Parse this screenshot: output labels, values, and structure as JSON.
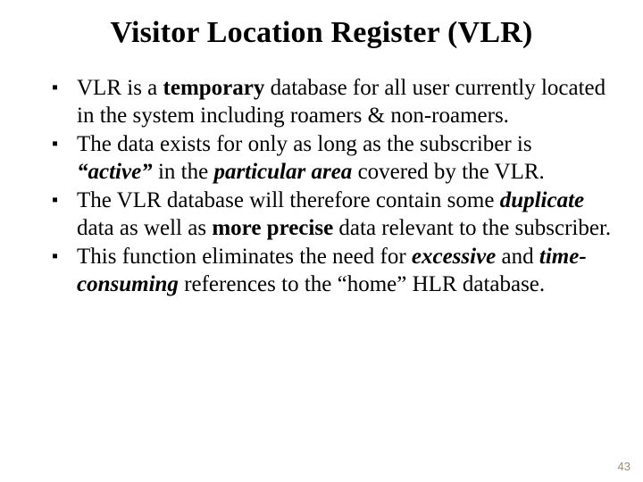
{
  "title": "Visitor Location Register (VLR)",
  "bullets": {
    "b1": {
      "t1": "VLR is a ",
      "t2": "temporary",
      "t3": " database for all user currently located in the system including roamers & non-roamers."
    },
    "b2": {
      "t1": "The data exists for only as long as the subscriber is ",
      "t2": "“active”",
      "t3": " in the ",
      "t4": "particular area",
      "t5": " covered by the VLR."
    },
    "b3": {
      "t1": "The VLR database will therefore contain some ",
      "t2": "duplicate",
      "t3": " data as well as ",
      "t4": "more precise",
      "t5": " data relevant to the subscriber."
    },
    "b4": {
      "t1": "This function eliminates the need for ",
      "t2": "excessive",
      "t3": " and ",
      "t4": "time-consuming",
      "t5": " references to the “home” HLR database."
    }
  },
  "page_number": "43"
}
